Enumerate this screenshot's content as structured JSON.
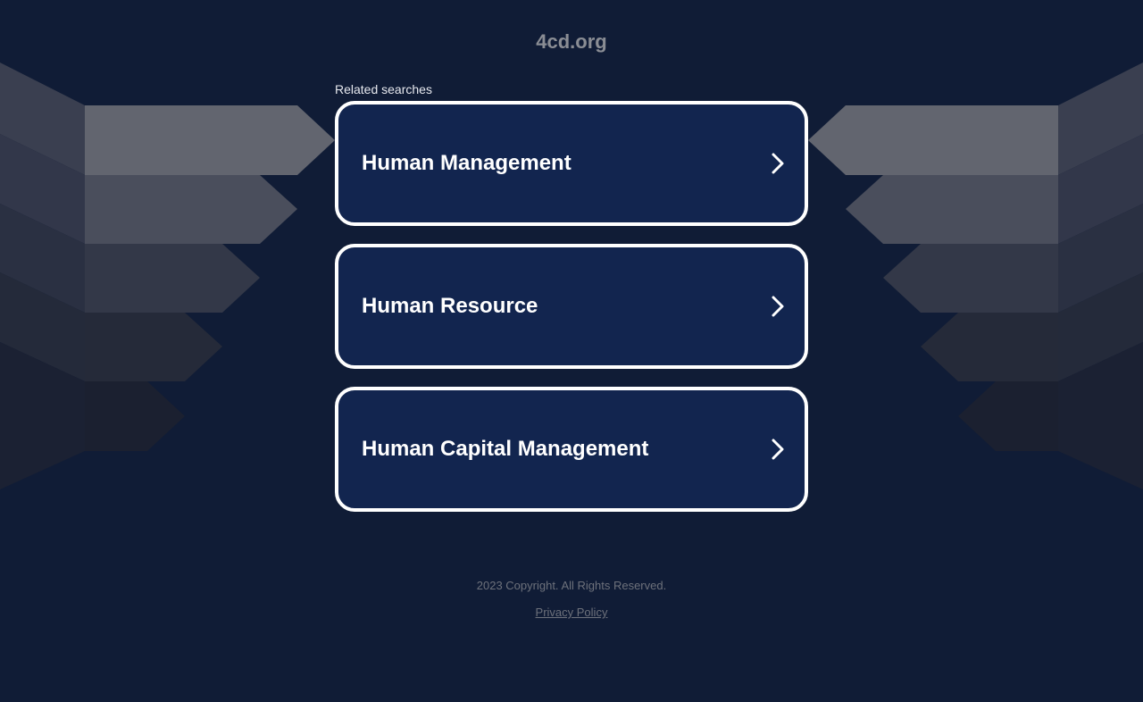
{
  "site": {
    "domain": "4cd.org"
  },
  "related": {
    "label": "Related searches",
    "items": [
      {
        "label": "Human Management",
        "icon": "chevron-right-icon"
      },
      {
        "label": "Human Resource",
        "icon": "chevron-right-icon"
      },
      {
        "label": "Human Capital Management",
        "icon": "chevron-right-icon"
      }
    ]
  },
  "footer": {
    "copyright": "2023 Copyright. All Rights Reserved.",
    "privacy_label": "Privacy Policy"
  },
  "colors": {
    "background": "#101c36",
    "card_background": "#12254f",
    "card_border": "#ffffff",
    "title": "#8a8d94",
    "footer_text": "#6d717b"
  }
}
